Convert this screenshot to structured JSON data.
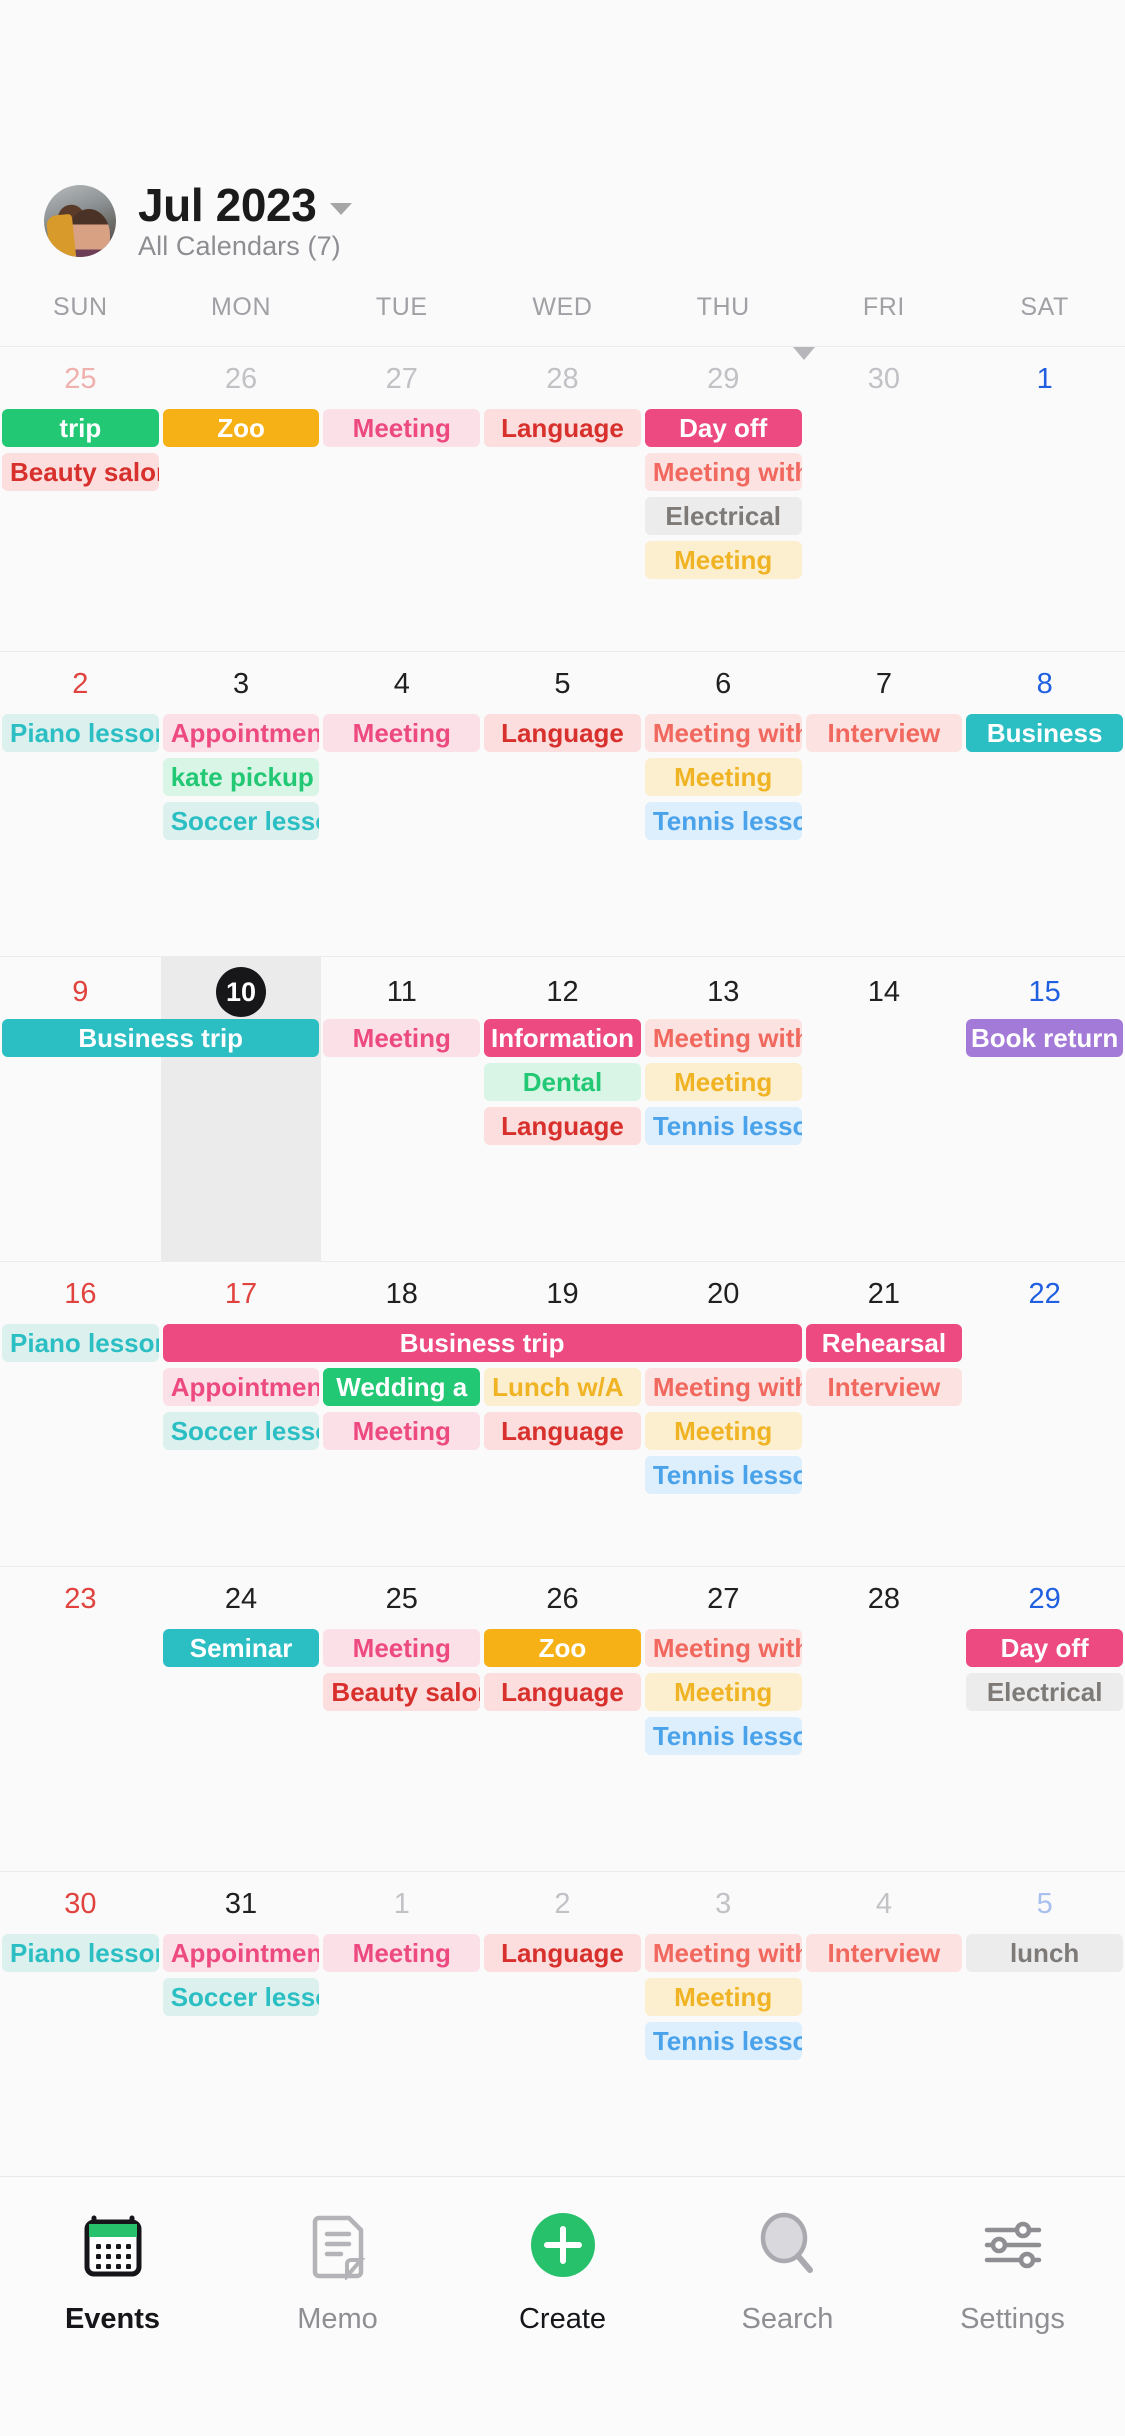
{
  "header": {
    "avatar_name": "user-avatar",
    "month_title": "Jul 2023",
    "subtitle": "All Calendars (7)",
    "dropdown_icon": "chevron-down-icon"
  },
  "weekdays": [
    "SUN",
    "MON",
    "TUE",
    "WED",
    "THU",
    "FRI",
    "SAT"
  ],
  "colors": {
    "sunday": "#e0433d",
    "saturday": "#1f5fe0",
    "today_bg": "#17171a",
    "selected_column": "#ebebeb",
    "create_accent": "#27c16b",
    "page_bg": "#fafafa"
  },
  "weeks": [
    {
      "days": [
        {
          "num": "25",
          "type": "out-sun"
        },
        {
          "num": "26",
          "type": "out"
        },
        {
          "num": "27",
          "type": "out"
        },
        {
          "num": "28",
          "type": "out"
        },
        {
          "num": "29",
          "type": "out"
        },
        {
          "num": "30",
          "type": "out"
        },
        {
          "num": "1",
          "type": "sat"
        }
      ],
      "events": [
        {
          "label": "trip",
          "col": 0,
          "span": 1,
          "style": "solid-green",
          "align": "center"
        },
        {
          "label": "Zoo",
          "col": 1,
          "span": 1,
          "style": "solid-amber",
          "align": "center"
        },
        {
          "label": "Meeting",
          "col": 2,
          "span": 1,
          "style": "soft-pink",
          "align": "center"
        },
        {
          "label": "Language",
          "col": 3,
          "span": 1,
          "style": "soft-red",
          "align": "center"
        },
        {
          "label": "Day off",
          "col": 4,
          "span": 1,
          "style": "solid-rose",
          "align": "center"
        },
        {
          "label": "Beauty salon",
          "col": 0,
          "span": 1,
          "style": "soft-red",
          "align": "left",
          "row": 1
        },
        {
          "label": "Meeting with",
          "col": 4,
          "span": 1,
          "style": "soft-salmon",
          "align": "left",
          "row": 1
        },
        {
          "label": "Electrical",
          "col": 4,
          "span": 1,
          "style": "soft-gray",
          "align": "center",
          "row": 2
        },
        {
          "label": "Meeting",
          "col": 4,
          "span": 1,
          "style": "soft-yellow",
          "align": "center",
          "row": 3
        }
      ]
    },
    {
      "days": [
        {
          "num": "2",
          "type": "sun"
        },
        {
          "num": "3",
          "type": "normal"
        },
        {
          "num": "4",
          "type": "normal"
        },
        {
          "num": "5",
          "type": "normal"
        },
        {
          "num": "6",
          "type": "normal"
        },
        {
          "num": "7",
          "type": "normal"
        },
        {
          "num": "8",
          "type": "sat"
        }
      ],
      "events": [
        {
          "label": "Piano lesson",
          "col": 0,
          "span": 1,
          "style": "soft-teal",
          "align": "left"
        },
        {
          "label": "Appointment",
          "col": 1,
          "span": 1,
          "style": "soft-pink",
          "align": "left"
        },
        {
          "label": "Meeting",
          "col": 2,
          "span": 1,
          "style": "soft-pink",
          "align": "center"
        },
        {
          "label": "Language",
          "col": 3,
          "span": 1,
          "style": "soft-red",
          "align": "center"
        },
        {
          "label": "Meeting with",
          "col": 4,
          "span": 1,
          "style": "soft-salmon",
          "align": "left"
        },
        {
          "label": "Interview",
          "col": 5,
          "span": 1,
          "style": "soft-salmon",
          "align": "center"
        },
        {
          "label": "Business",
          "col": 6,
          "span": 1,
          "style": "solid-teal",
          "align": "center"
        },
        {
          "label": "kate pickup",
          "col": 1,
          "span": 1,
          "style": "soft-green",
          "align": "left",
          "row": 1
        },
        {
          "label": "Meeting",
          "col": 4,
          "span": 1,
          "style": "soft-yellow",
          "align": "center",
          "row": 1
        },
        {
          "label": "Soccer lesson",
          "col": 1,
          "span": 1,
          "style": "soft-teal",
          "align": "left",
          "row": 2
        },
        {
          "label": "Tennis lesson",
          "col": 4,
          "span": 1,
          "style": "soft-blue",
          "align": "left",
          "row": 2
        }
      ]
    },
    {
      "selected_col": 1,
      "days": [
        {
          "num": "9",
          "type": "sun"
        },
        {
          "num": "10",
          "type": "today"
        },
        {
          "num": "11",
          "type": "normal"
        },
        {
          "num": "12",
          "type": "normal"
        },
        {
          "num": "13",
          "type": "normal"
        },
        {
          "num": "14",
          "type": "normal"
        },
        {
          "num": "15",
          "type": "sat"
        }
      ],
      "events": [
        {
          "label": "Business trip",
          "col": 0,
          "span": 2,
          "style": "solid-teal",
          "align": "center"
        },
        {
          "label": "Meeting",
          "col": 2,
          "span": 1,
          "style": "soft-pink",
          "align": "center"
        },
        {
          "label": "Information",
          "col": 3,
          "span": 1,
          "style": "solid-rose",
          "align": "center"
        },
        {
          "label": "Meeting with",
          "col": 4,
          "span": 1,
          "style": "soft-salmon",
          "align": "left"
        },
        {
          "label": "Book return",
          "col": 6,
          "span": 1,
          "style": "solid-purple",
          "align": "center"
        },
        {
          "label": "Dental",
          "col": 3,
          "span": 1,
          "style": "soft-green",
          "align": "center",
          "row": 1
        },
        {
          "label": "Meeting",
          "col": 4,
          "span": 1,
          "style": "soft-yellow",
          "align": "center",
          "row": 1
        },
        {
          "label": "Language",
          "col": 3,
          "span": 1,
          "style": "soft-red",
          "align": "center",
          "row": 2
        },
        {
          "label": "Tennis lesson",
          "col": 4,
          "span": 1,
          "style": "soft-blue",
          "align": "left",
          "row": 2
        }
      ]
    },
    {
      "days": [
        {
          "num": "16",
          "type": "sun"
        },
        {
          "num": "17",
          "type": "sun"
        },
        {
          "num": "18",
          "type": "normal"
        },
        {
          "num": "19",
          "type": "normal"
        },
        {
          "num": "20",
          "type": "normal"
        },
        {
          "num": "21",
          "type": "normal"
        },
        {
          "num": "22",
          "type": "sat"
        }
      ],
      "events": [
        {
          "label": "Piano lesson",
          "col": 0,
          "span": 1,
          "style": "soft-teal",
          "align": "left"
        },
        {
          "label": "Business trip",
          "col": 1,
          "span": 4,
          "style": "solid-rose",
          "align": "center"
        },
        {
          "label": "Rehearsal",
          "col": 5,
          "span": 1,
          "style": "solid-rose",
          "align": "center"
        },
        {
          "label": "Appointment",
          "col": 1,
          "span": 1,
          "style": "soft-pink",
          "align": "left",
          "row": 1
        },
        {
          "label": "Wedding a",
          "col": 2,
          "span": 1,
          "style": "solid-green",
          "align": "center",
          "row": 1
        },
        {
          "label": "Lunch w/A",
          "col": 3,
          "span": 1,
          "style": "soft-yellow",
          "align": "left",
          "row": 1
        },
        {
          "label": "Meeting with",
          "col": 4,
          "span": 1,
          "style": "soft-salmon",
          "align": "left",
          "row": 1
        },
        {
          "label": "Interview",
          "col": 5,
          "span": 1,
          "style": "soft-salmon",
          "align": "center",
          "row": 1
        },
        {
          "label": "Soccer lesson",
          "col": 1,
          "span": 1,
          "style": "soft-teal",
          "align": "left",
          "row": 2
        },
        {
          "label": "Meeting",
          "col": 2,
          "span": 1,
          "style": "soft-pink",
          "align": "center",
          "row": 2
        },
        {
          "label": "Language",
          "col": 3,
          "span": 1,
          "style": "soft-red",
          "align": "center",
          "row": 2
        },
        {
          "label": "Meeting",
          "col": 4,
          "span": 1,
          "style": "soft-yellow",
          "align": "center",
          "row": 2
        },
        {
          "label": "Tennis lesson",
          "col": 4,
          "span": 1,
          "style": "soft-blue",
          "align": "left",
          "row": 3
        }
      ]
    },
    {
      "days": [
        {
          "num": "23",
          "type": "sun"
        },
        {
          "num": "24",
          "type": "normal"
        },
        {
          "num": "25",
          "type": "normal"
        },
        {
          "num": "26",
          "type": "normal"
        },
        {
          "num": "27",
          "type": "normal"
        },
        {
          "num": "28",
          "type": "normal"
        },
        {
          "num": "29",
          "type": "sat"
        }
      ],
      "events": [
        {
          "label": "Seminar",
          "col": 1,
          "span": 1,
          "style": "solid-teal",
          "align": "center"
        },
        {
          "label": "Meeting",
          "col": 2,
          "span": 1,
          "style": "soft-pink",
          "align": "center"
        },
        {
          "label": "Zoo",
          "col": 3,
          "span": 1,
          "style": "solid-amber",
          "align": "center"
        },
        {
          "label": "Meeting with",
          "col": 4,
          "span": 1,
          "style": "soft-salmon",
          "align": "left"
        },
        {
          "label": "Day off",
          "col": 6,
          "span": 1,
          "style": "solid-rose",
          "align": "center"
        },
        {
          "label": "Beauty salon",
          "col": 2,
          "span": 1,
          "style": "soft-red",
          "align": "left",
          "row": 1
        },
        {
          "label": "Language",
          "col": 3,
          "span": 1,
          "style": "soft-red",
          "align": "center",
          "row": 1
        },
        {
          "label": "Meeting",
          "col": 4,
          "span": 1,
          "style": "soft-yellow",
          "align": "center",
          "row": 1
        },
        {
          "label": "Electrical",
          "col": 6,
          "span": 1,
          "style": "soft-gray",
          "align": "center",
          "row": 1
        },
        {
          "label": "Tennis lesson",
          "col": 4,
          "span": 1,
          "style": "soft-blue",
          "align": "left",
          "row": 2
        }
      ]
    },
    {
      "days": [
        {
          "num": "30",
          "type": "sun"
        },
        {
          "num": "31",
          "type": "normal"
        },
        {
          "num": "1",
          "type": "out"
        },
        {
          "num": "2",
          "type": "out"
        },
        {
          "num": "3",
          "type": "out"
        },
        {
          "num": "4",
          "type": "out"
        },
        {
          "num": "5",
          "type": "out-sat"
        }
      ],
      "events": [
        {
          "label": "Piano lesson",
          "col": 0,
          "span": 1,
          "style": "soft-teal",
          "align": "left"
        },
        {
          "label": "Appointment",
          "col": 1,
          "span": 1,
          "style": "soft-pink",
          "align": "left"
        },
        {
          "label": "Meeting",
          "col": 2,
          "span": 1,
          "style": "soft-pink",
          "align": "center"
        },
        {
          "label": "Language",
          "col": 3,
          "span": 1,
          "style": "soft-red",
          "align": "center"
        },
        {
          "label": "Meeting with",
          "col": 4,
          "span": 1,
          "style": "soft-salmon",
          "align": "left"
        },
        {
          "label": "Interview",
          "col": 5,
          "span": 1,
          "style": "soft-salmon",
          "align": "center"
        },
        {
          "label": "lunch",
          "col": 6,
          "span": 1,
          "style": "soft-gray",
          "align": "center"
        },
        {
          "label": "Soccer lesson",
          "col": 1,
          "span": 1,
          "style": "soft-teal",
          "align": "left",
          "row": 1
        },
        {
          "label": "Meeting",
          "col": 4,
          "span": 1,
          "style": "soft-yellow",
          "align": "center",
          "row": 1
        },
        {
          "label": "Tennis lesson",
          "col": 4,
          "span": 1,
          "style": "soft-blue",
          "align": "left",
          "row": 2
        }
      ]
    }
  ],
  "tabbar": {
    "items": [
      {
        "label": "Events",
        "icon": "calendar-icon",
        "active": true
      },
      {
        "label": "Memo",
        "icon": "note-icon",
        "active": false
      },
      {
        "label": "Create",
        "icon": "plus-circle-icon",
        "active": false
      },
      {
        "label": "Search",
        "icon": "search-icon",
        "active": false
      },
      {
        "label": "Settings",
        "icon": "sliders-icon",
        "active": false
      }
    ]
  }
}
